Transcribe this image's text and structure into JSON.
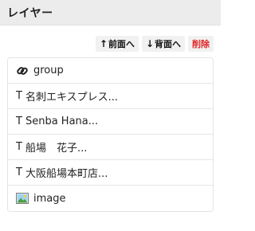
{
  "panel": {
    "title": "レイヤー"
  },
  "toolbar": {
    "bring_forward_arrow": "↑",
    "bring_forward_label": "前面へ",
    "send_backward_arrow": "↓",
    "send_backward_label": "背面へ",
    "delete_label": "削除",
    "delete_color": "#e02424"
  },
  "layers": [
    {
      "icon": "link-icon",
      "prefix": "",
      "label": "group"
    },
    {
      "icon": "",
      "prefix": "T",
      "label": "名刺エキスプレス..."
    },
    {
      "icon": "",
      "prefix": "T",
      "label": "Senba Hana..."
    },
    {
      "icon": "",
      "prefix": "T",
      "label": "船場　花子..."
    },
    {
      "icon": "",
      "prefix": "T",
      "label": "大阪船場本町店..."
    },
    {
      "icon": "image-icon",
      "prefix": "",
      "label": "image"
    }
  ]
}
